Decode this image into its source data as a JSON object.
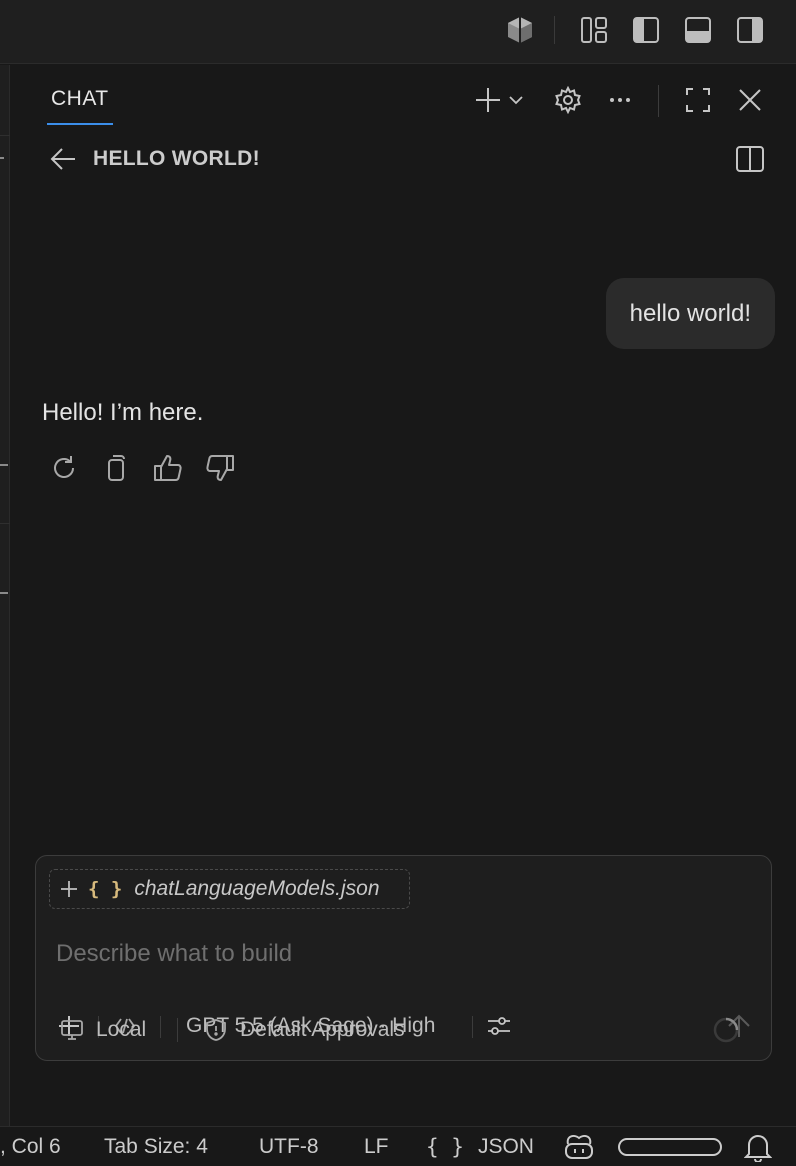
{
  "titlebar": {
    "icons": [
      "cube-icon",
      "layout-customize-icon",
      "toggle-primary-sidebar-icon",
      "toggle-panel-icon",
      "toggle-secondary-sidebar-icon"
    ]
  },
  "chat": {
    "tab_label": "CHAT",
    "session_title": "HELLO WORLD!",
    "messages": {
      "user": "hello world!",
      "assistant": "Hello! I’m here."
    },
    "input": {
      "context_braces": "{ }",
      "context_file": "chatLanguageModels.json",
      "placeholder": "Describe what to build",
      "value": "",
      "model": "GPT 5.5 (Ask Sage) · High"
    },
    "footer": {
      "location": "Local",
      "approvals": "Default Approvals"
    }
  },
  "statusbar": {
    "position": ", Col 6",
    "tab_size": "Tab Size: 4",
    "encoding": "UTF-8",
    "eol": "LF",
    "language_braces": "{ }",
    "language": "JSON"
  },
  "colors": {
    "background": "#181818",
    "chrome": "#1f1f1f",
    "accent": "#3b8eea",
    "json_braces": "#d7ba7d",
    "bubble": "#2b2b2b"
  }
}
